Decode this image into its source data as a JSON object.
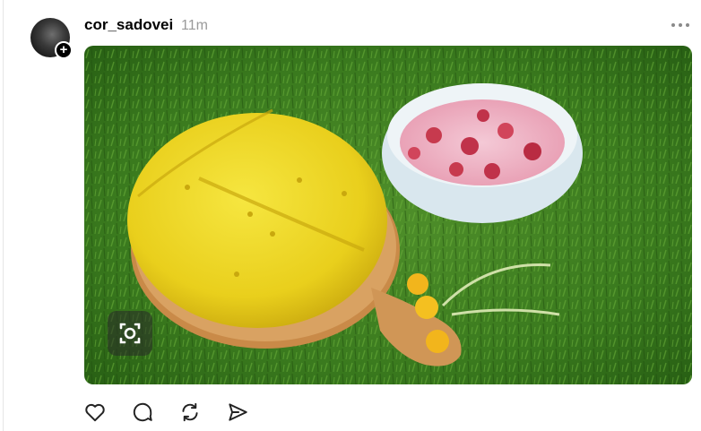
{
  "post": {
    "username": "cor_sadovei",
    "timestamp": "11m",
    "avatar_icon": "avatar-photo",
    "follow_icon": "plus-icon",
    "more_icon": "more-horizontal-icon",
    "image": {
      "description_icon": "photo",
      "lens_icon": "visual-search-icon"
    },
    "actions": [
      {
        "name": "like",
        "icon": "heart-icon"
      },
      {
        "name": "comment",
        "icon": "speech-bubble-icon"
      },
      {
        "name": "repost",
        "icon": "repost-icon"
      },
      {
        "name": "share",
        "icon": "send-icon"
      }
    ]
  },
  "colors": {
    "text": "#000000",
    "muted": "#9a9a9a",
    "background": "#ffffff"
  }
}
